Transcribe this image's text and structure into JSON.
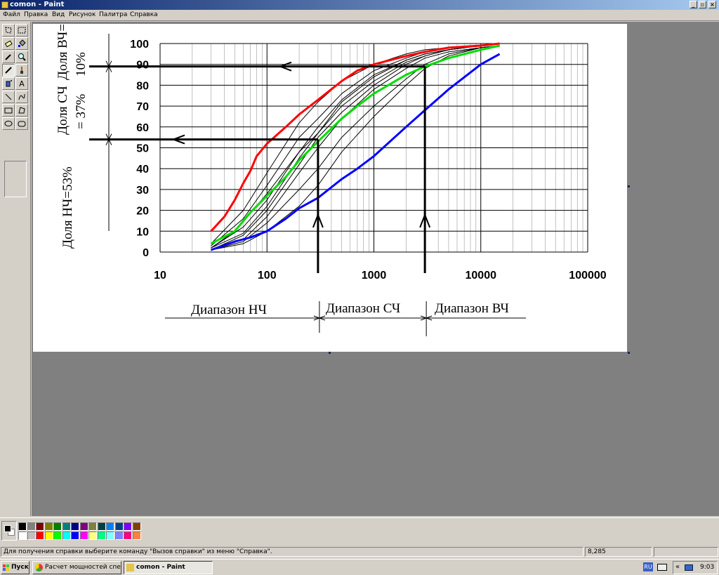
{
  "window": {
    "title": "comon - Paint",
    "min_glyph": "_",
    "max_glyph": "▫",
    "close_glyph": "×"
  },
  "menu": [
    "Файл",
    "Правка",
    "Вид",
    "Рисунок",
    "Палитра",
    "Справка"
  ],
  "toolbox": {
    "tools": [
      "free-select",
      "rect-select",
      "eraser",
      "fill",
      "color-picker",
      "magnifier",
      "pencil",
      "brush",
      "airbrush",
      "text",
      "line",
      "curve",
      "rectangle",
      "polygon",
      "ellipse",
      "rounded-rect"
    ],
    "active": "pencil",
    "text_tool_glyph": "A"
  },
  "chart_data": {
    "type": "line",
    "x_scale": "log",
    "xlim": [
      10,
      100000
    ],
    "ylim": [
      0,
      100
    ],
    "x_ticks": [
      "10",
      "100",
      "1000",
      "10000",
      "100000"
    ],
    "y_ticks": [
      "0",
      "10",
      "20",
      "30",
      "40",
      "50",
      "60",
      "70",
      "80",
      "90",
      "100"
    ],
    "series": [
      {
        "color": "#ff0000",
        "x": [
          30,
          40,
          50,
          60,
          70,
          80,
          100,
          150,
          200,
          300,
          500,
          700,
          1000,
          2000,
          3000,
          5000,
          10000,
          15000
        ],
        "y": [
          10,
          17,
          25,
          33,
          39,
          46,
          52,
          60,
          66,
          73,
          82,
          87,
          90,
          94,
          96,
          98,
          99,
          100
        ]
      },
      {
        "color": "#00dd00",
        "x": [
          30,
          50,
          70,
          100,
          150,
          200,
          300,
          500,
          700,
          1000,
          2000,
          3000,
          5000,
          10000,
          15000
        ],
        "y": [
          4,
          10,
          19,
          27,
          36,
          44,
          53,
          64,
          70,
          76,
          85,
          89,
          93,
          97,
          99
        ]
      },
      {
        "color": "#0000ff",
        "x": [
          30,
          50,
          70,
          100,
          150,
          200,
          300,
          500,
          700,
          1000,
          2000,
          3000,
          5000,
          10000,
          15000
        ],
        "y": [
          1,
          5,
          7,
          10,
          16,
          21,
          26,
          35,
          40,
          46,
          60,
          68,
          78,
          90,
          95
        ]
      },
      {
        "color": "#000000",
        "x": [
          30,
          50,
          100,
          200,
          300,
          500,
          1000,
          2000,
          3000,
          5000,
          10000,
          15000
        ],
        "y": [
          2,
          10,
          28,
          48,
          57,
          72,
          84,
          92,
          95,
          97,
          99,
          100
        ]
      },
      {
        "color": "#000000",
        "x": [
          30,
          60,
          100,
          200,
          300,
          500,
          1000,
          2000,
          3000,
          5000,
          10000,
          15000
        ],
        "y": [
          1,
          8,
          20,
          42,
          55,
          67,
          80,
          90,
          94,
          97,
          99,
          100
        ]
      },
      {
        "color": "#000000",
        "x": [
          30,
          60,
          100,
          200,
          300,
          500,
          1000,
          2000,
          3000,
          5000,
          10000,
          15000
        ],
        "y": [
          3,
          16,
          32,
          55,
          64,
          76,
          87,
          93,
          96,
          98,
          99,
          100
        ]
      },
      {
        "color": "#000000",
        "x": [
          30,
          60,
          100,
          200,
          300,
          500,
          1000,
          2000,
          3000,
          5000,
          10000,
          15000
        ],
        "y": [
          1,
          5,
          14,
          30,
          40,
          55,
          70,
          83,
          90,
          95,
          98,
          99
        ]
      },
      {
        "color": "#000000",
        "x": [
          30,
          60,
          100,
          200,
          300,
          500,
          1000,
          2000,
          3000,
          5000,
          10000,
          15000
        ],
        "y": [
          2,
          12,
          25,
          48,
          60,
          73,
          85,
          92,
          95,
          97,
          99,
          100
        ]
      },
      {
        "color": "#000000",
        "x": [
          30,
          60,
          100,
          200,
          300,
          500,
          1000,
          2000,
          3000,
          5000,
          10000,
          15000
        ],
        "y": [
          4,
          20,
          38,
          62,
          72,
          82,
          90,
          95,
          97,
          98,
          99,
          100
        ]
      },
      {
        "color": "#000000",
        "x": [
          30,
          60,
          100,
          200,
          300,
          500,
          1000,
          2000,
          3000,
          5000,
          10000,
          15000
        ],
        "y": [
          1,
          4,
          10,
          22,
          32,
          48,
          65,
          80,
          88,
          94,
          98,
          99
        ]
      },
      {
        "color": "#000000",
        "x": [
          30,
          60,
          100,
          200,
          300,
          500,
          1000,
          2000,
          3000,
          5000,
          10000,
          15000
        ],
        "y": [
          2,
          9,
          22,
          45,
          57,
          70,
          82,
          91,
          94,
          97,
          99,
          100
        ]
      },
      {
        "color": "#000000",
        "x": [
          30,
          60,
          100,
          200,
          300,
          500,
          1000,
          2000,
          3000,
          5000,
          10000,
          15000
        ],
        "y": [
          1,
          6,
          17,
          38,
          50,
          64,
          78,
          88,
          93,
          96,
          98,
          99
        ]
      }
    ],
    "annotations": {
      "y_share_hf": "Доля ВЧ=",
      "y_share_hf_pct": "10%",
      "y_share_mf": "Доля СЧ",
      "y_share_mf_pct": "= 37%",
      "y_share_lf": "Доля НЧ=53%",
      "range_lf": "Диапазон НЧ",
      "range_mf": "Диапазон СЧ",
      "range_hf": "Диапазон ВЧ",
      "lf_boundary_x": 300,
      "hf_boundary_x": 3000,
      "lf_level": 54,
      "hf_level": 89
    }
  },
  "palette": [
    "#000000",
    "#808080",
    "#800000",
    "#808000",
    "#008000",
    "#008080",
    "#000080",
    "#800080",
    "#808040",
    "#004040",
    "#0080ff",
    "#004080",
    "#8000ff",
    "#804000",
    "#ffffff",
    "#c0c0c0",
    "#ff0000",
    "#ffff00",
    "#00ff00",
    "#00ffff",
    "#0000ff",
    "#ff00ff",
    "#ffff80",
    "#00ff80",
    "#80ffff",
    "#8080ff",
    "#ff0080",
    "#ff8040"
  ],
  "status": {
    "help": "Для получения справки выберите команду \"Вызов справки\" из меню \"Справка\".",
    "coords": "8,285"
  },
  "taskbar": {
    "start": "Пуск",
    "tasks": [
      "Расчет мощностей спек...",
      "comon - Paint"
    ],
    "lang": "RU",
    "time": "9:03",
    "tray_arrow": "«"
  }
}
